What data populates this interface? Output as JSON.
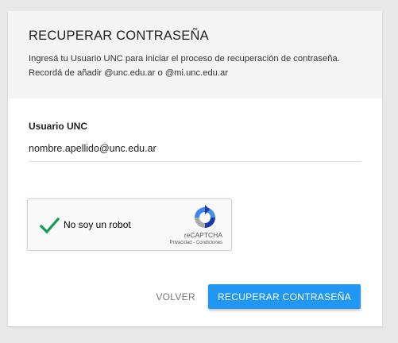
{
  "header": {
    "title": "RECUPERAR CONTRASEÑA",
    "description_line1": "Ingresá tu Usuario UNC para iniciar el proceso de recuperación de contraseña.",
    "description_line2": "Recordá de añadir @unc.edu.ar o @mi.unc.edu.ar"
  },
  "form": {
    "username_label": "Usuario UNC",
    "username_value": "nombre.apellido@unc.edu.ar"
  },
  "recaptcha": {
    "label": "No soy un robot",
    "brand": "reCAPTCHA",
    "privacy": "Privacidad",
    "separator": " - ",
    "terms": "Condiciones",
    "checked": true,
    "check_color": "#0f9d58"
  },
  "actions": {
    "back_label": "VOLVER",
    "submit_label": "RECUPERAR CONTRASEÑA"
  },
  "colors": {
    "primary": "#2196f3",
    "background": "#e8e8e8",
    "header_bg": "#f4f4f4"
  }
}
